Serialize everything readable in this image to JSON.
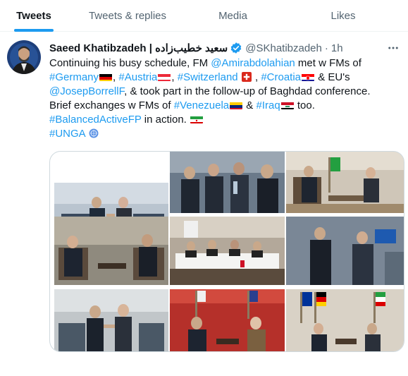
{
  "tabs": [
    {
      "label": "Tweets",
      "active": true
    },
    {
      "label": "Tweets & replies",
      "active": false
    },
    {
      "label": "Media",
      "active": false
    },
    {
      "label": "Likes",
      "active": false
    }
  ],
  "tweet": {
    "author_name": "Saeed Khatibzadeh | سعید خطیب‌زاده",
    "handle": "@SKhatibzadeh",
    "separator": "·",
    "time": "1h",
    "more_icon": "more-horizontal-icon",
    "verified_icon": "verified-badge-icon",
    "text": {
      "l1_a": "Continuing his busy schedule, FM ",
      "l1_mention": "@Amirabdolahian",
      "l1_b": " met w FMs of",
      "l2_germany": "#Germany",
      "l2_sep1": ", ",
      "l2_austria": "#Austria",
      "l2_sep2": ", ",
      "l2_switzerland": "#Switzerland",
      "l2_sep3": " , ",
      "l2_croatia": "#Croatia",
      "l2_b": " & EU's",
      "l3_mention": "@JosepBorrellF",
      "l3_b": ", & took part in the follow-up of Baghdad conference.",
      "l4_a": "Brief exchanges w FMs of ",
      "l4_venezuela": "#Venezuela",
      "l4_sep": " & ",
      "l4_iraq": "#Iraq",
      "l4_b": " too.",
      "l5_tag": "#BalancedActiveFP",
      "l5_b": " in action. ",
      "l6_tag": "#UNGA"
    },
    "flags": [
      "germany-flag",
      "austria-flag",
      "switzerland-flag",
      "croatia-flag",
      "venezuela-flag",
      "iraq-flag",
      "iran-flag",
      "un-emblem"
    ],
    "photos": [
      "photo-meeting-handshake-germany",
      "photo-delegation-hall",
      "photo-meeting-room-flags",
      "photo-seated-bilateral",
      "photo-conference-table",
      "photo-standing-conversation",
      "photo-handshake-croatia",
      "photo-seated-red-room",
      "photo-meeting-eu-flags"
    ]
  },
  "colors": {
    "accent": "#1d9bf0",
    "text": "#0f1419",
    "secondary": "#536471",
    "border": "#cfd9de"
  }
}
